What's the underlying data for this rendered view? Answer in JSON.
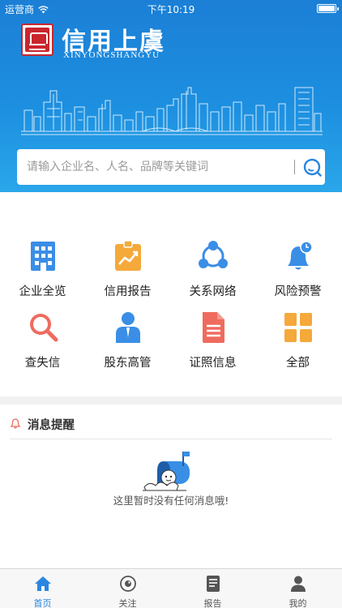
{
  "status_bar": {
    "carrier": "运营商",
    "time": "下午10:19"
  },
  "brand": {
    "title": "信用上虞",
    "subtitle": "XINYONGSHANGYU"
  },
  "search": {
    "placeholder": "请输入企业名、人名、品牌等关键词"
  },
  "grid": {
    "items": [
      {
        "label": "企业全览",
        "icon": "building-icon",
        "color": "#3a8ee6"
      },
      {
        "label": "信用报告",
        "icon": "report-chart-icon",
        "color": "#f5a93b"
      },
      {
        "label": "关系网络",
        "icon": "network-icon",
        "color": "#3a8ee6"
      },
      {
        "label": "风险预警",
        "icon": "alarm-bell-icon",
        "color": "#3a8ee6"
      },
      {
        "label": "查失信",
        "icon": "search-magnifier-icon",
        "color": "#ef6b5e"
      },
      {
        "label": "股东高管",
        "icon": "shareholder-person-icon",
        "color": "#3a8ee6"
      },
      {
        "label": "证照信息",
        "icon": "license-document-icon",
        "color": "#ef6b5e"
      },
      {
        "label": "全部",
        "icon": "all-grid-icon",
        "color": "#f5a93b"
      }
    ]
  },
  "messages": {
    "title": "消息提醒",
    "empty_text": "这里暂时没有任何消息哦!"
  },
  "tabbar": {
    "active_color": "#2a86e0",
    "tabs": [
      {
        "label": "首页",
        "icon": "home-icon"
      },
      {
        "label": "关注",
        "icon": "follow-eye-icon"
      },
      {
        "label": "报告",
        "icon": "report-doc-icon"
      },
      {
        "label": "我的",
        "icon": "profile-icon"
      }
    ]
  }
}
